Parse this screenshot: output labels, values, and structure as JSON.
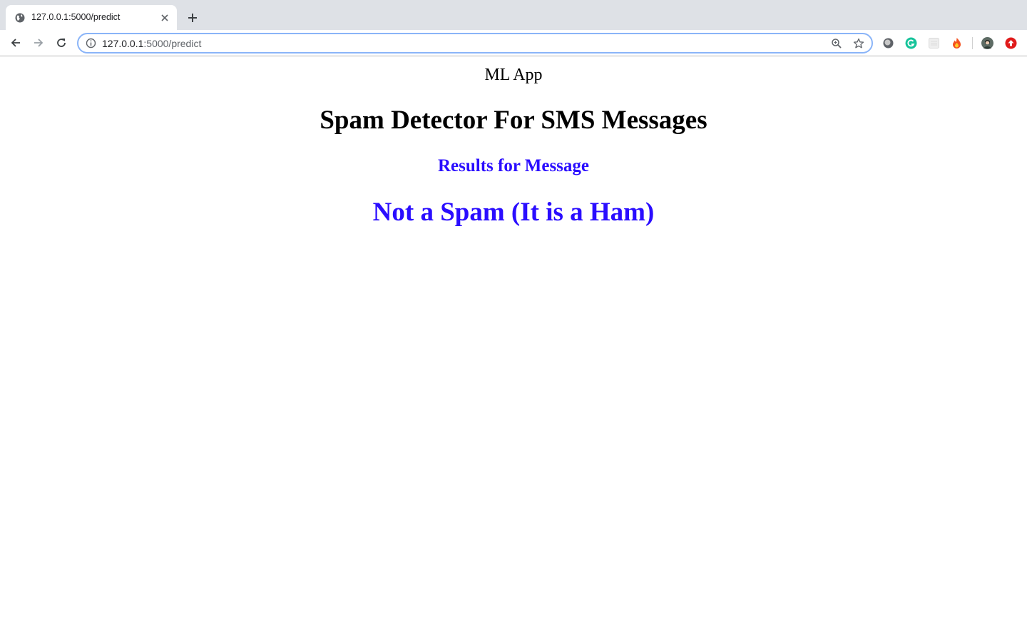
{
  "browser": {
    "tab": {
      "title": "127.0.0.1:5000/predict",
      "favicon": "globe-icon"
    },
    "address_bar": {
      "host": "127.0.0.1",
      "path": ":5000/predict"
    },
    "icons": {
      "back": "arrow-left-icon",
      "forward": "arrow-right-icon",
      "reload": "reload-icon",
      "info": "info-icon",
      "zoom": "zoom-icon",
      "bookmark": "star-icon",
      "new_tab": "plus-icon",
      "close_tab": "close-icon"
    },
    "extensions": [
      "extension-gray-icon",
      "grammarly-icon",
      "extension-grid-icon",
      "fire-icon",
      "profile-avatar",
      "upload-icon"
    ]
  },
  "page": {
    "app_label": "ML App",
    "heading": "Spam Detector For SMS Messages",
    "results_heading": "Results for Message",
    "result": "Not a Spam (It is a Ham)"
  },
  "colors": {
    "accent": "#2a0dff",
    "tabstrip": "#dee1e6",
    "omnibox_border": "#8ab4f8"
  }
}
